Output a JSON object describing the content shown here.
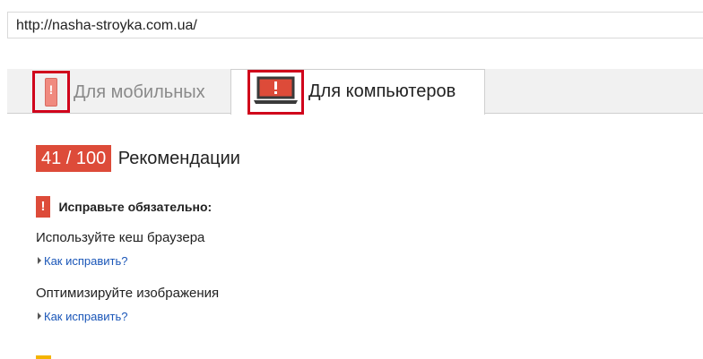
{
  "url_field": {
    "value": "http://nasha-stroyka.com.ua/"
  },
  "tabs": {
    "mobile": {
      "label": "Для мобильных",
      "icon": "mobile-phone-warning-icon"
    },
    "desktop": {
      "label": "Для компьютеров",
      "icon": "laptop-warning-icon",
      "active": true
    }
  },
  "summary": {
    "score": "41 / 100",
    "title": "Рекомендации",
    "badge_color": "#dd4b39"
  },
  "section": {
    "heading": "Исправьте обязательно:",
    "icon_mark": "!",
    "rules": [
      {
        "title": "Используйте кеш браузера",
        "link": "Как исправить?"
      },
      {
        "title": "Оптимизируйте изображения",
        "link": "Как исправить?"
      }
    ]
  },
  "colors": {
    "alert_red": "#dd4b39",
    "highlight_border": "#d0021b",
    "link_blue": "#1a56b8",
    "warning_yellow": "#f4b400"
  }
}
